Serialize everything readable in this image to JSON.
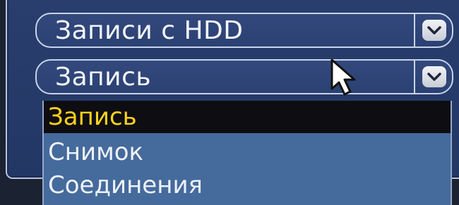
{
  "filters": {
    "source": {
      "value": "Записи с HDD",
      "icon": "chevron-down-icon"
    },
    "type": {
      "value": "Запись",
      "icon": "chevron-down-icon",
      "expanded": true,
      "options": [
        {
          "label": "Запись",
          "selected": true
        },
        {
          "label": "Снимок",
          "selected": false
        },
        {
          "label": "Соединения",
          "selected": false
        }
      ]
    }
  },
  "cursor": {
    "icon": "mouse-pointer-icon"
  },
  "colors": {
    "panel_bg": "#253a68",
    "dropdown_bg": "#456a9c",
    "highlight_bg": "#0d0d12",
    "highlight_text": "#ffd21a",
    "text": "#f4f6fb"
  }
}
